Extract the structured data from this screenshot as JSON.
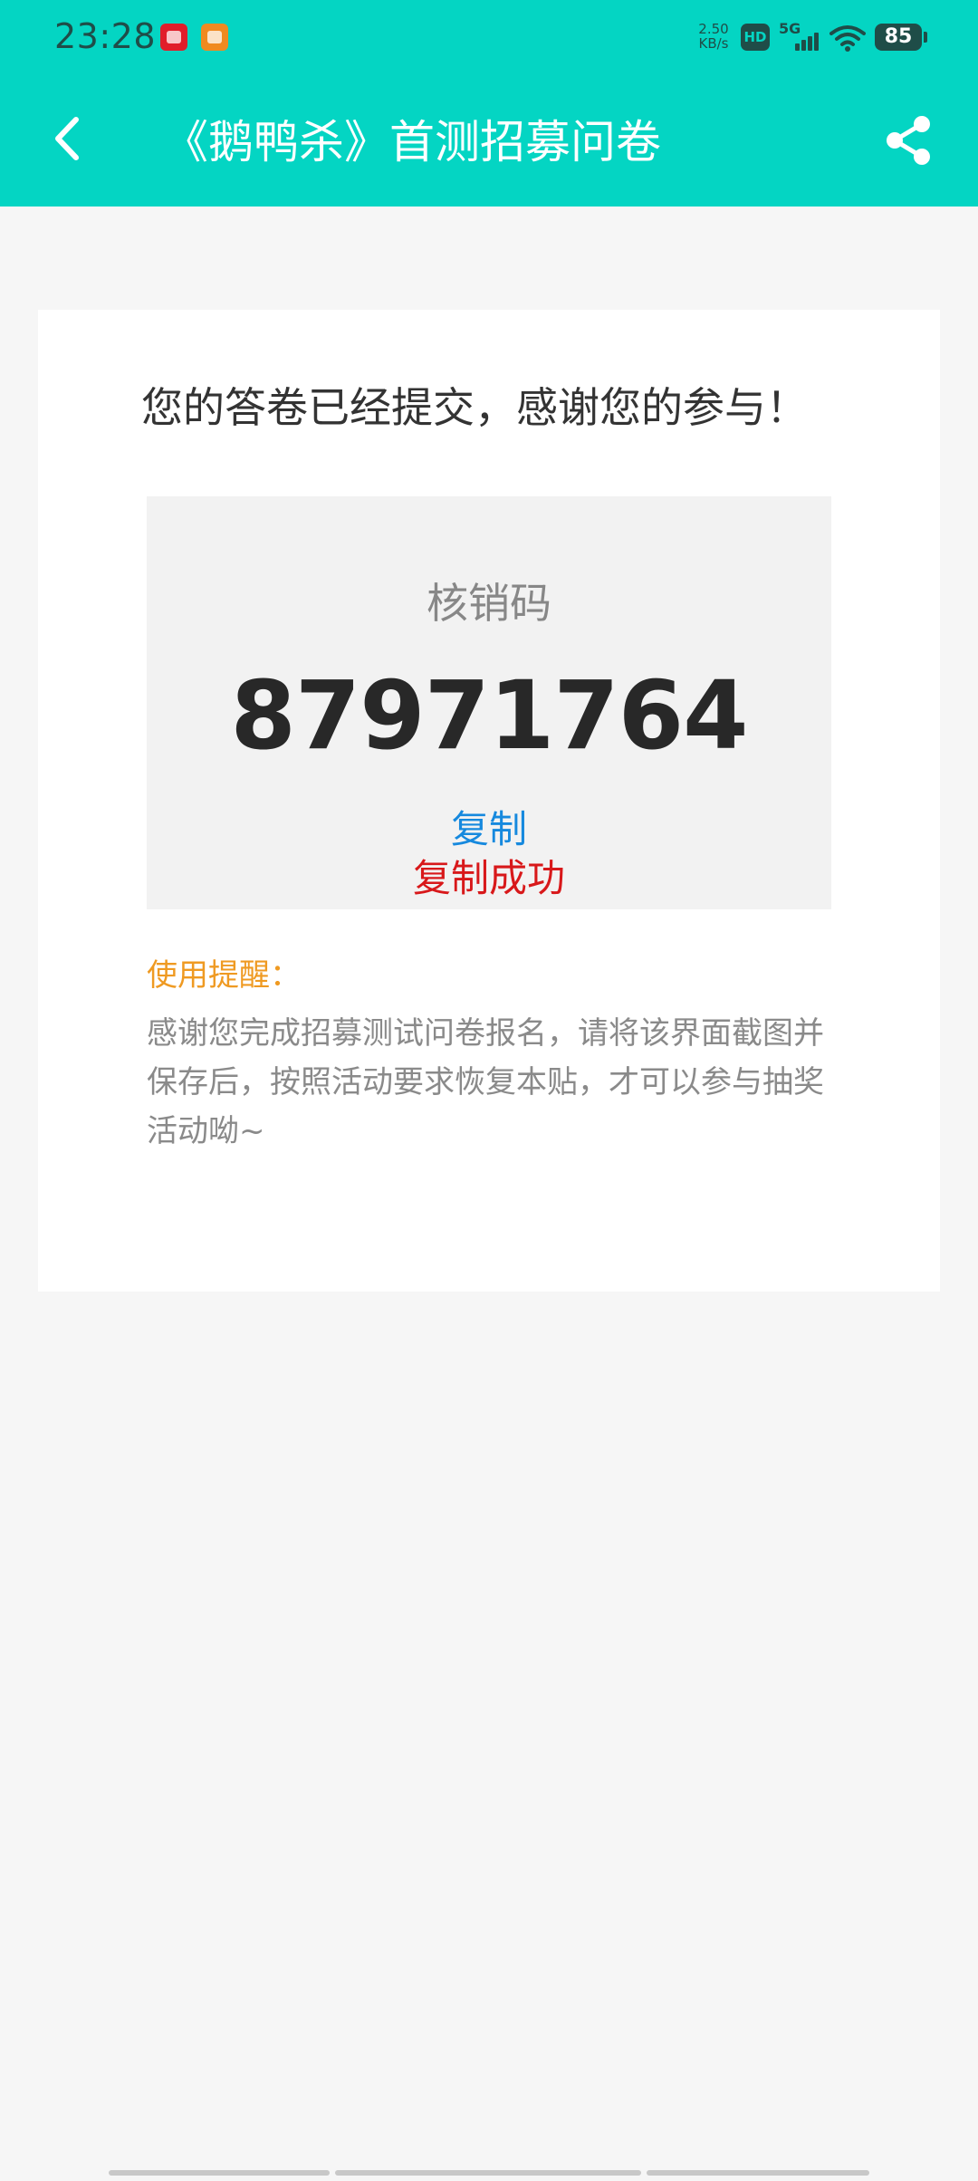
{
  "status_bar": {
    "time": "23:28",
    "net_speed_value": "2.50",
    "net_speed_unit": "KB/s",
    "hd_label": "HD",
    "network_type": "5G",
    "battery": "85",
    "notification_icons": [
      "red-app-icon",
      "orange-app-icon"
    ]
  },
  "header": {
    "title": "《鹅鸭杀》首测招募问卷",
    "background_color": "#04d5c3",
    "back_icon": "chevron-left-icon",
    "share_icon": "share-icon"
  },
  "card": {
    "success_message": "您的答卷已经提交，感谢您的参与！",
    "code_label": "核销码",
    "code_value": "87971764",
    "copy_label": "复制",
    "copy_success": "复制成功",
    "reminder_title": "使用提醒：",
    "reminder_text": "感谢您完成招募测试问卷报名，请将该界面截图并保存后，按照活动要求恢复本贴，才可以参与抽奖活动呦~"
  },
  "colors": {
    "accent_teal": "#04d5c3",
    "copy_blue": "#1689de",
    "success_red": "#d8181a",
    "reminder_orange": "#ef9a22"
  }
}
